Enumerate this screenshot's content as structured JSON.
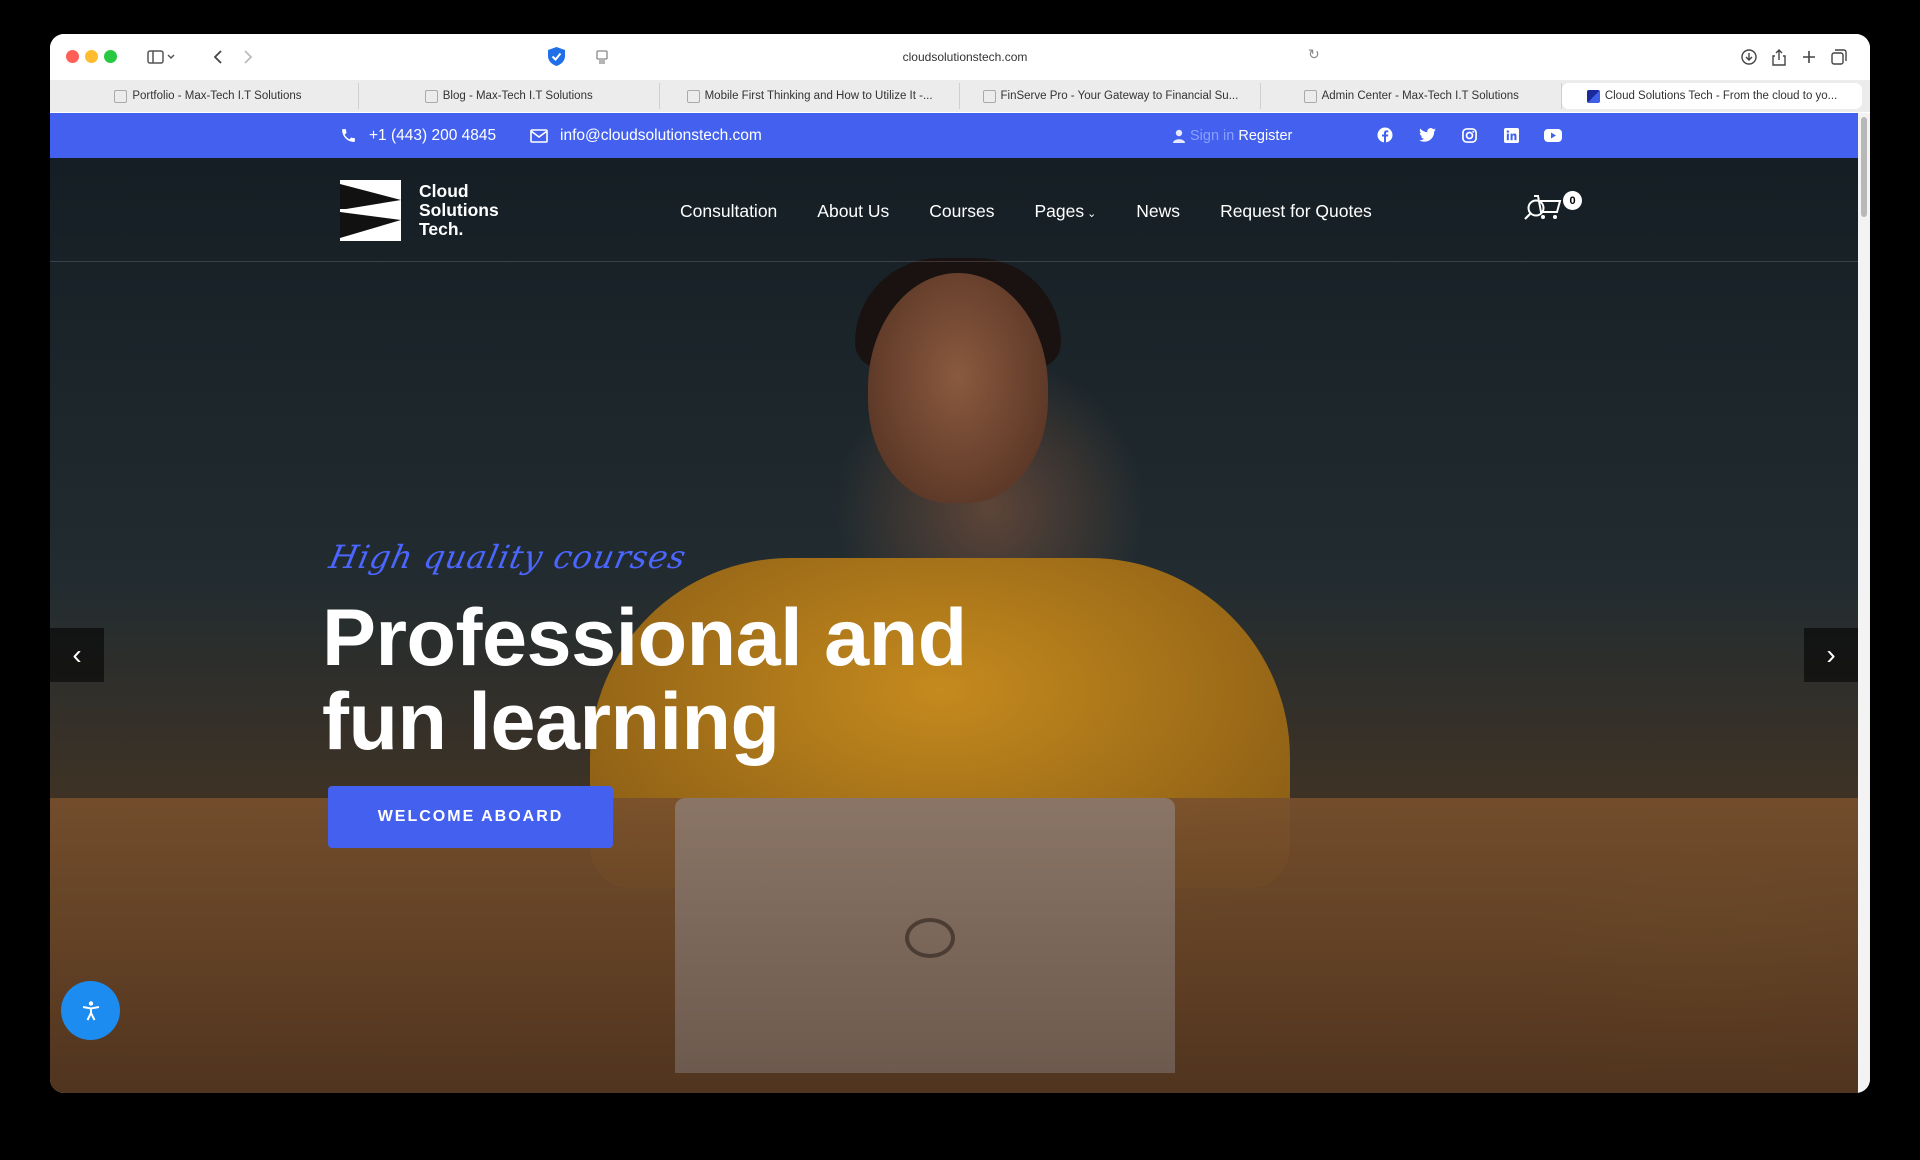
{
  "browser": {
    "url": "cloudsolutionstech.com",
    "tabs": [
      {
        "label": "Portfolio - Max-Tech I.T Solutions",
        "active": false
      },
      {
        "label": "Blog - Max-Tech I.T Solutions",
        "active": false
      },
      {
        "label": "Mobile First Thinking and How to Utilize It -...",
        "active": false
      },
      {
        "label": "FinServe Pro - Your Gateway to Financial Su...",
        "active": false
      },
      {
        "label": "Admin Center - Max-Tech I.T Solutions",
        "active": false
      },
      {
        "label": "Cloud Solutions Tech - From the cloud to yo...",
        "active": true
      }
    ]
  },
  "topbar": {
    "phone": "+1 (443) 200 4845",
    "email": "info@cloudsolutionstech.com",
    "sign_in": "Sign in",
    "register": "Register",
    "social_icons": [
      "facebook-icon",
      "twitter-icon",
      "instagram-icon",
      "linkedin-icon",
      "youtube-icon"
    ],
    "accent": "#4361ee"
  },
  "header": {
    "logo_line1": "Cloud",
    "logo_line2": "Solutions",
    "logo_line3": "Tech.",
    "nav": [
      "Consultation",
      "About Us",
      "Courses",
      "Pages",
      "News",
      "Request for Quotes"
    ],
    "cart_count": "0"
  },
  "hero": {
    "tagline": "High quality courses",
    "headline_line1": "Professional and",
    "headline_line2": "fun learning",
    "cta": "WELCOME ABOARD",
    "prev": "‹",
    "next": "›"
  }
}
